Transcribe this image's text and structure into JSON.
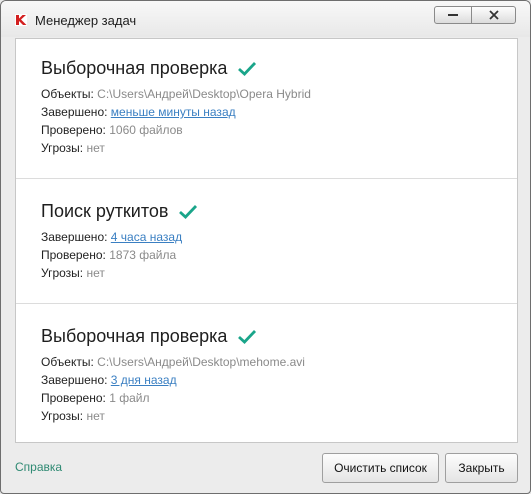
{
  "window": {
    "title": "Менеджер задач",
    "minimize_glyph": "–",
    "close_glyph": "✕"
  },
  "tasks": [
    {
      "title": "Выборочная проверка",
      "status_icon": "check-icon",
      "rows": [
        {
          "label": "Объекты:",
          "value": "C:\\Users\\Андрей\\Desktop\\Opera Hybrid",
          "link": false
        },
        {
          "label": "Завершено:",
          "value": "меньше минуты назад",
          "link": true
        },
        {
          "label": "Проверено:",
          "value": "1060 файлов",
          "link": false
        },
        {
          "label": "Угрозы:",
          "value": "нет",
          "link": false
        }
      ]
    },
    {
      "title": "Поиск руткитов",
      "status_icon": "check-icon",
      "rows": [
        {
          "label": "Завершено:",
          "value": "4 часа назад",
          "link": true
        },
        {
          "label": "Проверено:",
          "value": "1873 файла",
          "link": false
        },
        {
          "label": "Угрозы:",
          "value": "нет",
          "link": false
        }
      ]
    },
    {
      "title": "Выборочная проверка",
      "status_icon": "check-icon",
      "rows": [
        {
          "label": "Объекты:",
          "value": "C:\\Users\\Андрей\\Desktop\\mehome.avi",
          "link": false
        },
        {
          "label": "Завершено:",
          "value": "3 дня назад",
          "link": true
        },
        {
          "label": "Проверено:",
          "value": "1 файл",
          "link": false
        },
        {
          "label": "Угрозы:",
          "value": "нет",
          "link": false
        }
      ]
    }
  ],
  "footer": {
    "help_link": "Справка",
    "clear_button": "Очистить список",
    "close_button": "Закрыть"
  },
  "colors": {
    "check": "#1aa58a",
    "link": "#3a7fc2",
    "help_link": "#2f8a73"
  }
}
